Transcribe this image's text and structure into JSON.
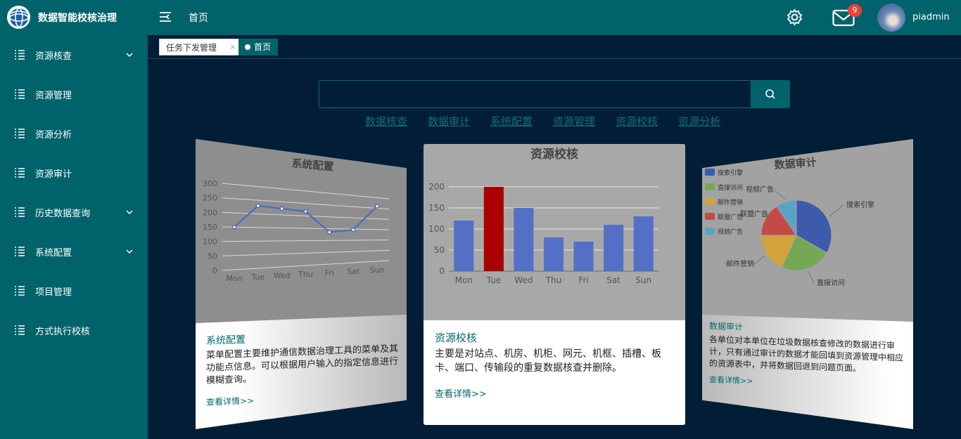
{
  "header": {
    "app_title": "数据智能校核治理",
    "home": "首页",
    "mail_count": "9",
    "username": "piadmin",
    "icons": [
      "logo-globe-icon",
      "menu-toggle-icon",
      "gear-icon",
      "mail-icon"
    ]
  },
  "sidebar": {
    "items": [
      {
        "label": "资源核查",
        "expandable": true
      },
      {
        "label": "资源管理",
        "expandable": false
      },
      {
        "label": "资源分析",
        "expandable": false
      },
      {
        "label": "资源审计",
        "expandable": false
      },
      {
        "label": "历史数据查询",
        "expandable": true
      },
      {
        "label": "系统配置",
        "expandable": true
      },
      {
        "label": "项目管理",
        "expandable": false
      },
      {
        "label": "方式执行校核",
        "expandable": false
      }
    ]
  },
  "tabs": [
    {
      "label": "任务下发管理",
      "close": "×"
    },
    {
      "label": "首页"
    }
  ],
  "search": {
    "value": "",
    "placeholder": ""
  },
  "quick_links": [
    "数据核查",
    "数据审计",
    "系统配置",
    "资源管理",
    "资源校核",
    "资源分析"
  ],
  "cards": {
    "left": {
      "title": "系统配置",
      "desc": "菜单配置主要维护通信数据治理工具的菜单及其功能点信息。可以根据用户输入的指定信息进行模糊查询。",
      "more": "查看详情>>"
    },
    "middle": {
      "title": "资源校核",
      "desc": "主要是对站点、机房、机柜、网元、机框、插槽、板卡、端口、传输段的重复数据核查并删除。",
      "more": "查看详情>>"
    },
    "right": {
      "title": "数据审计",
      "desc": "各单位对本单位在垃圾数据核查修改的数据进行审计，只有通过审计的数据才能回填到资源管理中相应的资源表中，并将数据回退到问题页面。",
      "more": "查看详情>>"
    }
  },
  "chart_data": [
    {
      "type": "line",
      "title": "系统配置",
      "categories": [
        "Mon",
        "Tue",
        "Wed",
        "Thu",
        "Fri",
        "Sat",
        "Sun"
      ],
      "values": [
        150,
        230,
        224,
        218,
        135,
        147,
        260
      ],
      "ylim": [
        0,
        300
      ],
      "yticks": [
        0,
        50,
        100,
        150,
        200,
        250,
        300
      ],
      "color": "#4a67c4"
    },
    {
      "type": "bar",
      "title": "资源校核",
      "categories": [
        "Mon",
        "Tue",
        "Wed",
        "Thu",
        "Fri",
        "Sat",
        "Sun"
      ],
      "values": [
        120,
        200,
        150,
        80,
        70,
        110,
        130
      ],
      "highlight_index": 1,
      "ylim": [
        0,
        200
      ],
      "yticks": [
        0,
        50,
        100,
        150,
        200
      ],
      "color": "#5470c6",
      "highlight_color": "#a90000"
    },
    {
      "type": "pie",
      "title": "数据审计",
      "legend": [
        "搜索引擎",
        "直接访问",
        "邮件营销",
        "联盟广告",
        "视频广告"
      ],
      "values": [
        1048,
        735,
        580,
        484,
        300
      ],
      "colors": [
        "#3d5baa",
        "#75a855",
        "#d2a33a",
        "#c44a46",
        "#5ba3c3"
      ]
    }
  ]
}
